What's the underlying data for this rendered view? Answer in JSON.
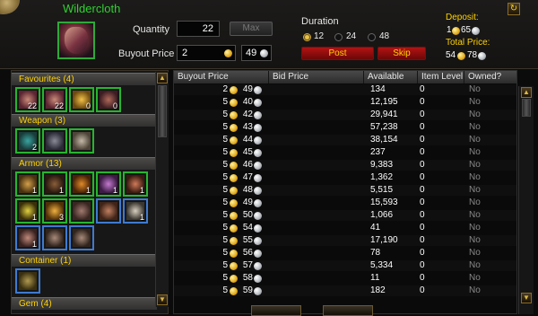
{
  "item": {
    "name": "Wildercloth",
    "icon": "wildercloth-item-icon"
  },
  "sell": {
    "quantity_label": "Quantity",
    "quantity_value": "22",
    "max_label": "Max",
    "buyout_label": "Buyout Price",
    "buyout_gold": "2",
    "buyout_silver": "49"
  },
  "duration": {
    "title": "Duration",
    "options": [
      "12",
      "24",
      "48"
    ],
    "selected": "12",
    "post_label": "Post",
    "skip_label": "Skip"
  },
  "deposit": {
    "label": "Deposit:",
    "gold": "1",
    "silver": "65",
    "total_label": "Total Price:",
    "total_gold": "54",
    "total_silver": "78"
  },
  "refresh_icon": "refresh-icon",
  "categories": [
    {
      "label": "Favourites (4)",
      "counts": [
        "22",
        "22",
        "0",
        "0"
      ]
    },
    {
      "label": "Weapon (3)",
      "counts": [
        "2",
        "",
        ""
      ]
    },
    {
      "label": "Armor (13)",
      "counts": [
        "1",
        "1",
        "1",
        "1",
        "1",
        "1",
        "3",
        "",
        "",
        "1",
        "1",
        "",
        ""
      ]
    },
    {
      "label": "Container (1)",
      "counts": [
        ""
      ]
    },
    {
      "label": "Gem (4)",
      "counts": []
    }
  ],
  "table": {
    "headers": [
      "Buyout Price",
      "Bid Price",
      "Available",
      "Item Level",
      "Owned?"
    ],
    "rows": [
      {
        "gold": "2",
        "silver": "49",
        "available": "134",
        "ilvl": "0",
        "owned": "No"
      },
      {
        "gold": "5",
        "silver": "40",
        "available": "12,195",
        "ilvl": "0",
        "owned": "No"
      },
      {
        "gold": "5",
        "silver": "42",
        "available": "29,941",
        "ilvl": "0",
        "owned": "No"
      },
      {
        "gold": "5",
        "silver": "43",
        "available": "57,238",
        "ilvl": "0",
        "owned": "No"
      },
      {
        "gold": "5",
        "silver": "44",
        "available": "38,154",
        "ilvl": "0",
        "owned": "No"
      },
      {
        "gold": "5",
        "silver": "45",
        "available": "237",
        "ilvl": "0",
        "owned": "No"
      },
      {
        "gold": "5",
        "silver": "46",
        "available": "9,383",
        "ilvl": "0",
        "owned": "No"
      },
      {
        "gold": "5",
        "silver": "47",
        "available": "1,362",
        "ilvl": "0",
        "owned": "No"
      },
      {
        "gold": "5",
        "silver": "48",
        "available": "5,515",
        "ilvl": "0",
        "owned": "No"
      },
      {
        "gold": "5",
        "silver": "49",
        "available": "15,593",
        "ilvl": "0",
        "owned": "No"
      },
      {
        "gold": "5",
        "silver": "50",
        "available": "1,066",
        "ilvl": "0",
        "owned": "No"
      },
      {
        "gold": "5",
        "silver": "54",
        "available": "41",
        "ilvl": "0",
        "owned": "No"
      },
      {
        "gold": "5",
        "silver": "55",
        "available": "17,190",
        "ilvl": "0",
        "owned": "No"
      },
      {
        "gold": "5",
        "silver": "56",
        "available": "78",
        "ilvl": "0",
        "owned": "No"
      },
      {
        "gold": "5",
        "silver": "57",
        "available": "5,334",
        "ilvl": "0",
        "owned": "No"
      },
      {
        "gold": "5",
        "silver": "58",
        "available": "11",
        "ilvl": "0",
        "owned": "No"
      },
      {
        "gold": "5",
        "silver": "59",
        "available": "182",
        "ilvl": "0",
        "owned": "No"
      }
    ]
  },
  "colors": {
    "item_quality": "#2fd12f",
    "gold_text": "#ffd200",
    "button_red": "#b31313",
    "slot_green": "#27b52f",
    "slot_blue": "#3f7ad0"
  }
}
